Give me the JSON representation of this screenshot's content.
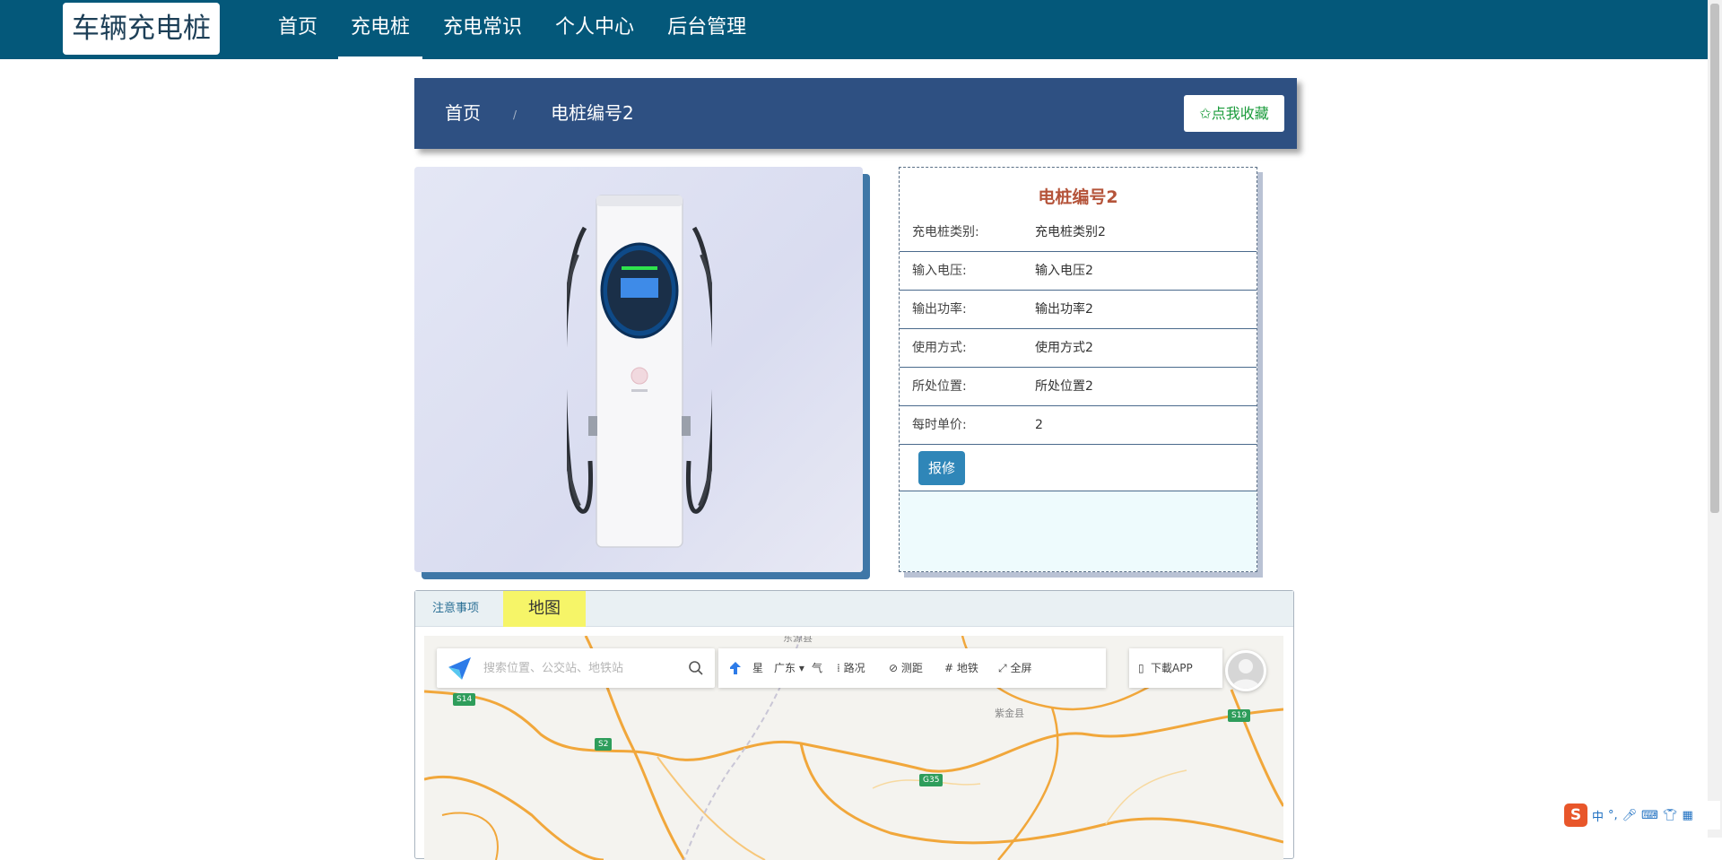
{
  "logo": "车辆充电桩",
  "nav": {
    "items": [
      {
        "label": "首页",
        "active": false
      },
      {
        "label": "充电桩",
        "active": true
      },
      {
        "label": "充电常识",
        "active": false
      },
      {
        "label": "个人中心",
        "active": false
      },
      {
        "label": "后台管理",
        "active": false
      }
    ]
  },
  "breadcrumb": {
    "home": "首页",
    "separator": "/",
    "current": "电桩编号2",
    "favorite_label": "✩点我收藏"
  },
  "detail": {
    "title": "电桩编号2",
    "rows": [
      {
        "label": "充电桩类别:",
        "value": "充电桩类别2"
      },
      {
        "label": "输入电压:",
        "value": "输入电压2"
      },
      {
        "label": "输出功率:",
        "value": "输出功率2"
      },
      {
        "label": "使用方式:",
        "value": "使用方式2"
      },
      {
        "label": "所处位置:",
        "value": "所处位置2"
      },
      {
        "label": "每时单价:",
        "value": "2"
      }
    ],
    "repair_label": "报修"
  },
  "tabs": {
    "notes": "注意事项",
    "map": "地图"
  },
  "map": {
    "search_placeholder": "搜索位置、公交站、地铁站",
    "toolbar": {
      "weather_fragment_left": "星",
      "region": "广东",
      "weather_fragment_right": "气",
      "traffic": "路况",
      "measure": "测距",
      "subway": "地铁",
      "fullscreen": "全屏"
    },
    "download_app": "下載APP",
    "place_labels": {
      "top": "东源县",
      "right": "紫金县"
    },
    "shields": [
      "S14",
      "S2",
      "G35",
      "S19"
    ]
  },
  "ime": {
    "logo": "S",
    "lang": "中"
  },
  "colors": {
    "nav_bg": "#04587a",
    "breadcrumb_bg": "#2e5082",
    "favorite_text": "#1a9b3b",
    "title_color": "#b5543a",
    "repair_button": "#2f86b8",
    "map_tab_active": "#f6f568"
  }
}
